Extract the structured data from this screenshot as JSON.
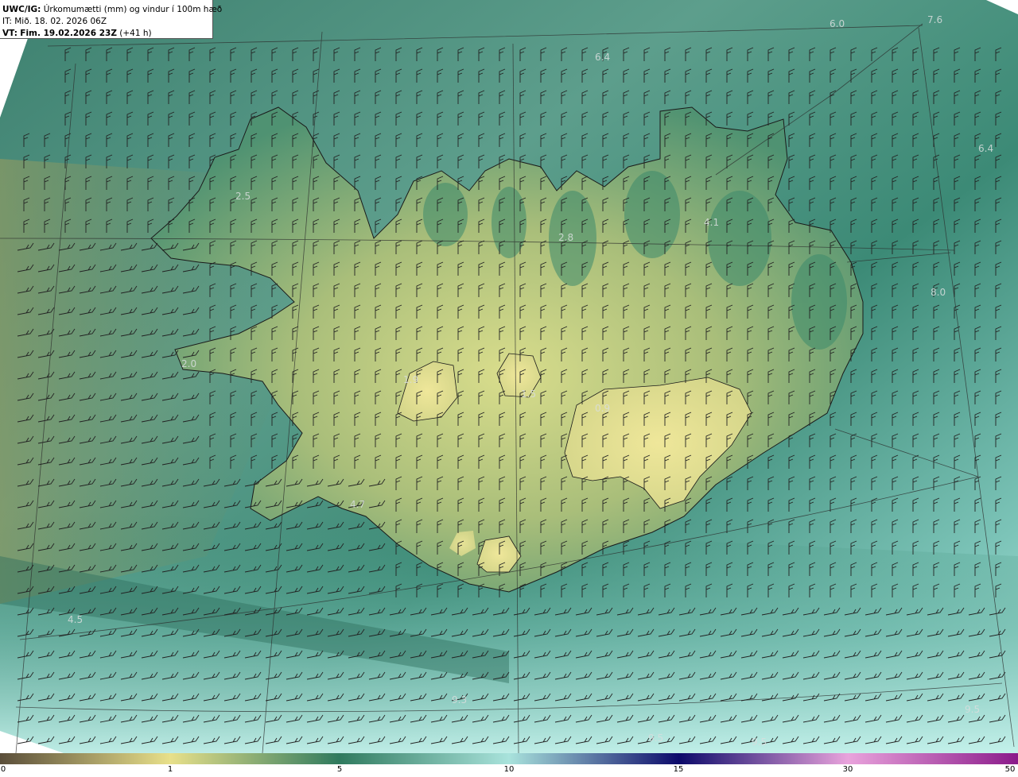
{
  "header": {
    "model": "UWC/IG:",
    "title": "Úrkomumætti (mm) og vindur í 100m hæð",
    "it_label": "IT:",
    "it_value": "Mið. 18. 02. 2026 06Z",
    "vt_label": "VT:",
    "vt_value": "Fim. 19.02.2026 23Z",
    "vt_lead": "(+41 h)"
  },
  "colorbar": {
    "ticks": [
      "0",
      "1",
      "5",
      "10",
      "15",
      "30",
      "50"
    ],
    "colors": [
      "#5a4e3a",
      "#e8e08a",
      "#2f7a5e",
      "#a9e3dc",
      "#0c0a6a",
      "#e9a3dc",
      "#8a1a8a"
    ]
  },
  "value_labels": [
    "6.0",
    "7.6",
    "6.4",
    "6.4",
    "2.5",
    "4.1",
    "8.0",
    "2.8",
    "2.0",
    "1.9",
    "1.5",
    "0.9",
    "4.7",
    "4.5",
    "9.3",
    "9.5",
    "9.5",
    "9.5"
  ],
  "colors": {
    "coast": "#1a1a1a",
    "grid": "#2b2b2b",
    "barb": "#222222",
    "sea_dark": "#2f7566",
    "sea_light": "#a8e0d8",
    "land_low": "#e7e18c"
  }
}
